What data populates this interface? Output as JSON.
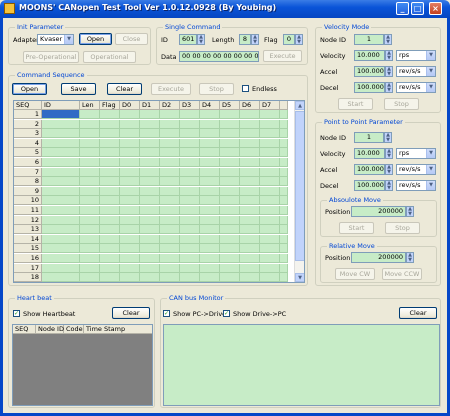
{
  "window": {
    "title": "MOONS' CANopen Test Tool Ver 1.0.12.0928 (By Youbing)",
    "min": "_",
    "max": "□",
    "close": "×"
  },
  "init": {
    "title": "Init Parameter",
    "adapter_label": "Adapter",
    "adapter_value": "Kvaser",
    "open": "Open",
    "close": "Close",
    "preop": "Pre-Operational",
    "operational": "Operational"
  },
  "single": {
    "title": "Single Command",
    "id_label": "ID",
    "id_value": "601",
    "length_label": "Length",
    "length_value": "8",
    "flag_label": "Flag",
    "flag_value": "0",
    "data_label": "Data",
    "data_value": "00 00 00 00 00 00 00 00",
    "execute": "Execute"
  },
  "seq": {
    "title": "Command Sequence",
    "open": "Open",
    "save": "Save",
    "clear": "Clear",
    "execute": "Execute",
    "stop": "Stop",
    "endless": "Endless",
    "columns": [
      "SEQ",
      "ID",
      "Len",
      "Flag",
      "D0",
      "D1",
      "D2",
      "D3",
      "D4",
      "D5",
      "D6",
      "D7"
    ],
    "rows": [
      "1",
      "2",
      "3",
      "4",
      "5",
      "6",
      "7",
      "8",
      "9",
      "10",
      "11",
      "12",
      "13",
      "14",
      "15",
      "16",
      "17",
      "18"
    ]
  },
  "velocity": {
    "title": "Velocity Mode",
    "node_label": "Node ID",
    "node_value": "1",
    "vel_label": "Velocity",
    "vel_value": "10.000",
    "vel_unit": "rps",
    "accel_label": "Accel",
    "accel_value": "100.000",
    "accel_unit": "rev/s/s",
    "decel_label": "Decel",
    "decel_value": "100.000",
    "decel_unit": "rev/s/s",
    "start": "Start",
    "stop": "Stop"
  },
  "p2p": {
    "title": "Point to Point Parameter",
    "node_label": "Node ID",
    "node_value": "1",
    "vel_label": "Velocity",
    "vel_value": "10.000",
    "vel_unit": "rps",
    "accel_label": "Accel",
    "accel_value": "100.000",
    "accel_unit": "rev/s/s",
    "decel_label": "Decel",
    "decel_value": "100.000",
    "decel_unit": "rev/s/s",
    "abs_title": "Absoulote Move",
    "abs_pos_label": "Position",
    "abs_pos_value": "200000",
    "abs_start": "Start",
    "abs_stop": "Stop",
    "rel_title": "Relative Move",
    "rel_pos_label": "Position",
    "rel_pos_value": "200000",
    "move_cw": "Move CW",
    "move_ccw": "Move CCW"
  },
  "heartbeat": {
    "title": "Heart beat",
    "show": "Show Heartbeat",
    "clear": "Clear",
    "columns": [
      "SEQ",
      "Node ID",
      "Code",
      "Time Stamp"
    ]
  },
  "canbus": {
    "title": "CAN bus Monitor",
    "pc_drive": "Show PC->Drive",
    "drive_pc": "Show Drive->PC",
    "clear": "Clear"
  },
  "colors": {
    "title_bar": "#0a54d8",
    "group_label": "#0046d5",
    "cell_bg": "#c7ecc7",
    "selected_cell": "#316ac5"
  }
}
